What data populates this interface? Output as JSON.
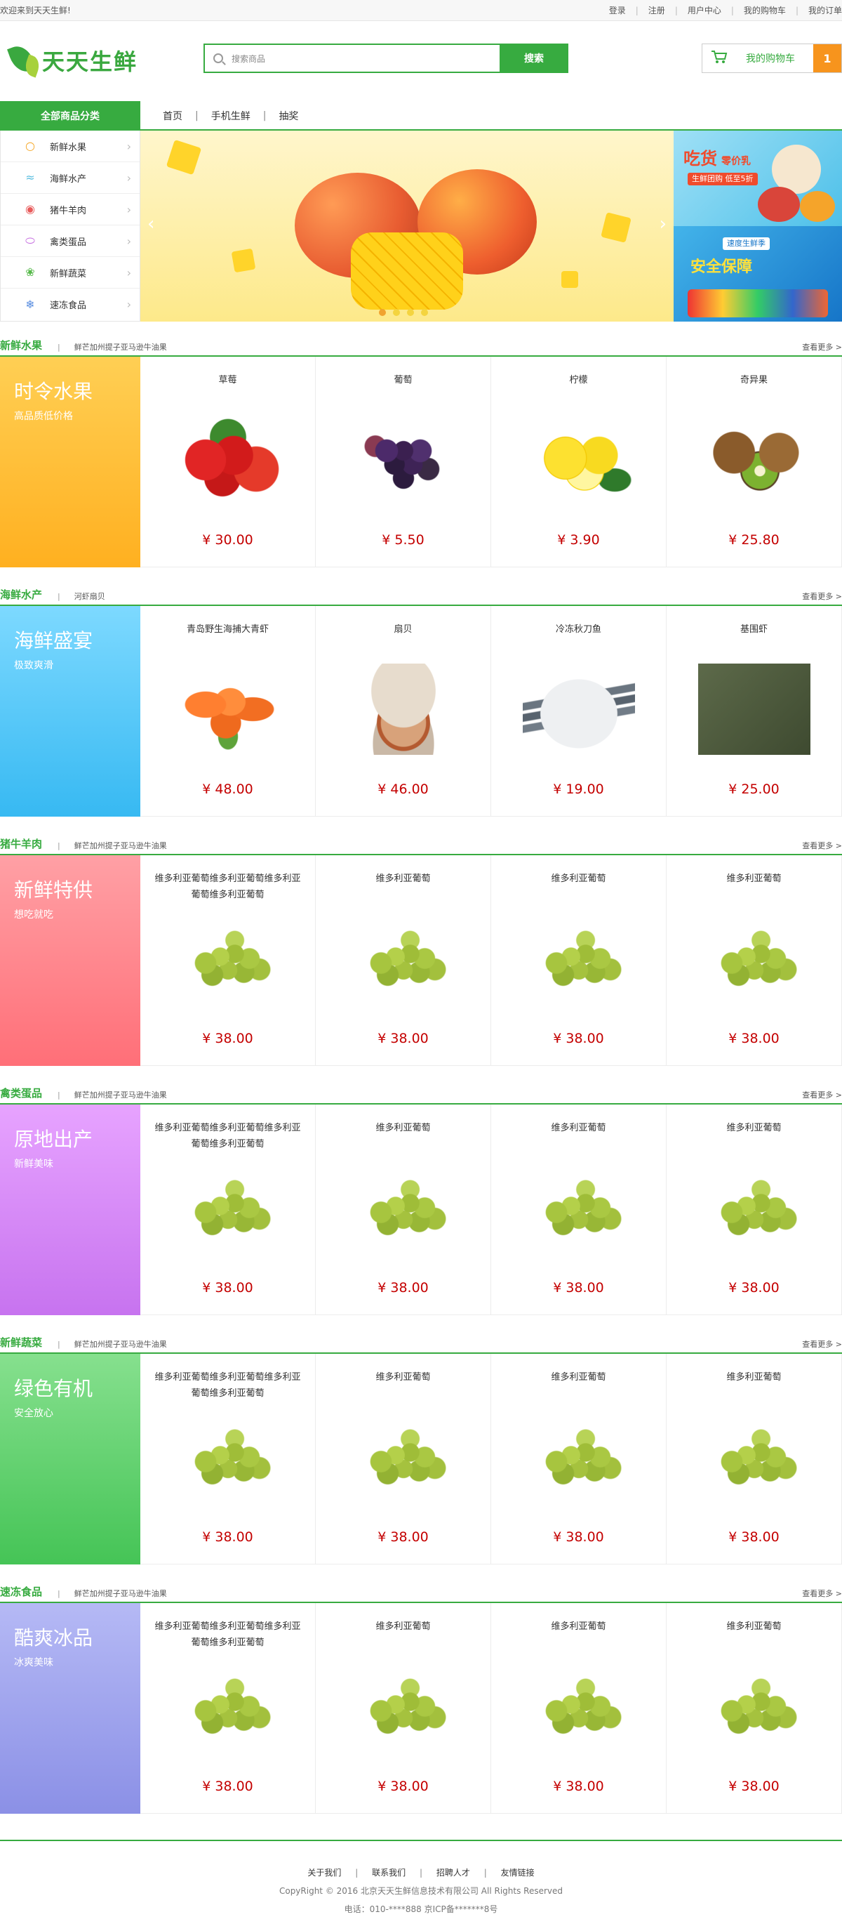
{
  "topbar": {
    "welcome": "欢迎来到天天生鲜!",
    "links": [
      "登录",
      "注册",
      "用户中心",
      "我的购物车",
      "我的订单"
    ]
  },
  "header": {
    "logo_text": "天天生鲜",
    "search_placeholder": "搜索商品",
    "search_button": "搜索",
    "cart_label": "我的购物车",
    "cart_count": "1"
  },
  "nav": {
    "all_categories": "全部商品分类",
    "links": [
      "首页",
      "手机生鲜",
      "抽奖"
    ]
  },
  "categories": [
    {
      "label": "新鲜水果",
      "icon": "fruit-icon"
    },
    {
      "label": "海鲜水产",
      "icon": "seafood-icon"
    },
    {
      "label": "猪牛羊肉",
      "icon": "meat-icon"
    },
    {
      "label": "禽类蛋品",
      "icon": "egg-icon"
    },
    {
      "label": "新鲜蔬菜",
      "icon": "vegetable-icon"
    },
    {
      "label": "速冻食品",
      "icon": "snowflake-icon"
    }
  ],
  "banner": {
    "ad1_title": "吃货",
    "ad1_title2": "零价乳",
    "ad1_tag": "生鲜团购 低至5折",
    "ad2_title": "安全保障",
    "ad2_tag": "速度生鲜季"
  },
  "floors": [
    {
      "title": "新鲜水果",
      "subs": [
        "鲜芒",
        "加州提子",
        "亚马逊牛油果"
      ],
      "more": "查看更多 >",
      "promo_title": "时令水果",
      "promo_sub": "高品质低价格",
      "promo_color1": "#ffcf54",
      "promo_color2": "#ffb020",
      "goods": [
        {
          "name": "草莓",
          "price": "¥ 30.00",
          "pic": "strawberry"
        },
        {
          "name": "葡萄",
          "price": "¥ 5.50",
          "pic": "grape-purple"
        },
        {
          "name": "柠檬",
          "price": "¥ 3.90",
          "pic": "lemon"
        },
        {
          "name": "奇异果",
          "price": "¥ 25.80",
          "pic": "kiwi"
        }
      ]
    },
    {
      "title": "海鲜水产",
      "subs": [
        "河虾",
        "扇贝"
      ],
      "more": "查看更多 >",
      "promo_title": "海鲜盛宴",
      "promo_sub": "极致爽滑",
      "promo_color1": "#7dd9ff",
      "promo_color2": "#37b9f2",
      "goods": [
        {
          "name": "青岛野生海捕大青虾",
          "price": "¥ 48.00",
          "pic": "shrimp"
        },
        {
          "name": "扇贝",
          "price": "¥ 46.00",
          "pic": "scallop"
        },
        {
          "name": "冷冻秋刀鱼",
          "price": "¥ 19.00",
          "pic": "fish"
        },
        {
          "name": "基围虾",
          "price": "¥ 25.00",
          "pic": "prawn"
        }
      ]
    },
    {
      "title": "猪牛羊肉",
      "subs": [
        "鲜芒",
        "加州提子",
        "亚马逊牛油果"
      ],
      "more": "查看更多 >",
      "promo_title": "新鲜特供",
      "promo_sub": "想吃就吃",
      "promo_color1": "#ffa0a5",
      "promo_color2": "#ff6f78",
      "goods": [
        {
          "name": "维多利亚葡萄维多利亚葡萄维多利亚葡萄维多利亚葡萄",
          "price": "¥ 38.00",
          "pic": "grape-green"
        },
        {
          "name": "维多利亚葡萄",
          "price": "¥ 38.00",
          "pic": "grape-green"
        },
        {
          "name": "维多利亚葡萄",
          "price": "¥ 38.00",
          "pic": "grape-green"
        },
        {
          "name": "维多利亚葡萄",
          "price": "¥ 38.00",
          "pic": "grape-green"
        }
      ]
    },
    {
      "title": "禽类蛋品",
      "subs": [
        "鲜芒",
        "加州提子",
        "亚马逊牛油果"
      ],
      "more": "查看更多 >",
      "promo_title": "原地出产",
      "promo_sub": "新鲜美味",
      "promo_color1": "#e7a3ff",
      "promo_color2": "#c773ef",
      "goods": [
        {
          "name": "维多利亚葡萄维多利亚葡萄维多利亚葡萄维多利亚葡萄",
          "price": "¥ 38.00",
          "pic": "grape-green"
        },
        {
          "name": "维多利亚葡萄",
          "price": "¥ 38.00",
          "pic": "grape-green"
        },
        {
          "name": "维多利亚葡萄",
          "price": "¥ 38.00",
          "pic": "grape-green"
        },
        {
          "name": "维多利亚葡萄",
          "price": "¥ 38.00",
          "pic": "grape-green"
        }
      ]
    },
    {
      "title": "新鲜蔬菜",
      "subs": [
        "鲜芒",
        "加州提子",
        "亚马逊牛油果"
      ],
      "more": "查看更多 >",
      "promo_title": "绿色有机",
      "promo_sub": "安全放心",
      "promo_color1": "#86e08e",
      "promo_color2": "#45c456",
      "goods": [
        {
          "name": "维多利亚葡萄维多利亚葡萄维多利亚葡萄维多利亚葡萄",
          "price": "¥ 38.00",
          "pic": "grape-green"
        },
        {
          "name": "维多利亚葡萄",
          "price": "¥ 38.00",
          "pic": "grape-green"
        },
        {
          "name": "维多利亚葡萄",
          "price": "¥ 38.00",
          "pic": "grape-green"
        },
        {
          "name": "维多利亚葡萄",
          "price": "¥ 38.00",
          "pic": "grape-green"
        }
      ]
    },
    {
      "title": "速冻食品",
      "subs": [
        "鲜芒",
        "加州提子",
        "亚马逊牛油果"
      ],
      "more": "查看更多 >",
      "promo_title": "酷爽冰品",
      "promo_sub": "冰爽美味",
      "promo_color1": "#b5b9f5",
      "promo_color2": "#8b90e6",
      "goods": [
        {
          "name": "维多利亚葡萄维多利亚葡萄维多利亚葡萄维多利亚葡萄",
          "price": "¥ 38.00",
          "pic": "grape-green"
        },
        {
          "name": "维多利亚葡萄",
          "price": "¥ 38.00",
          "pic": "grape-green"
        },
        {
          "name": "维多利亚葡萄",
          "price": "¥ 38.00",
          "pic": "grape-green"
        },
        {
          "name": "维多利亚葡萄",
          "price": "¥ 38.00",
          "pic": "grape-green"
        }
      ]
    }
  ],
  "footer": {
    "links": [
      "关于我们",
      "联系我们",
      "招聘人才",
      "友情链接"
    ],
    "copyright": "CopyRight © 2016 北京天天生鲜信息技术有限公司 All Rights Reserved",
    "tel": "电话：010-****888 京ICP备*******8号"
  }
}
